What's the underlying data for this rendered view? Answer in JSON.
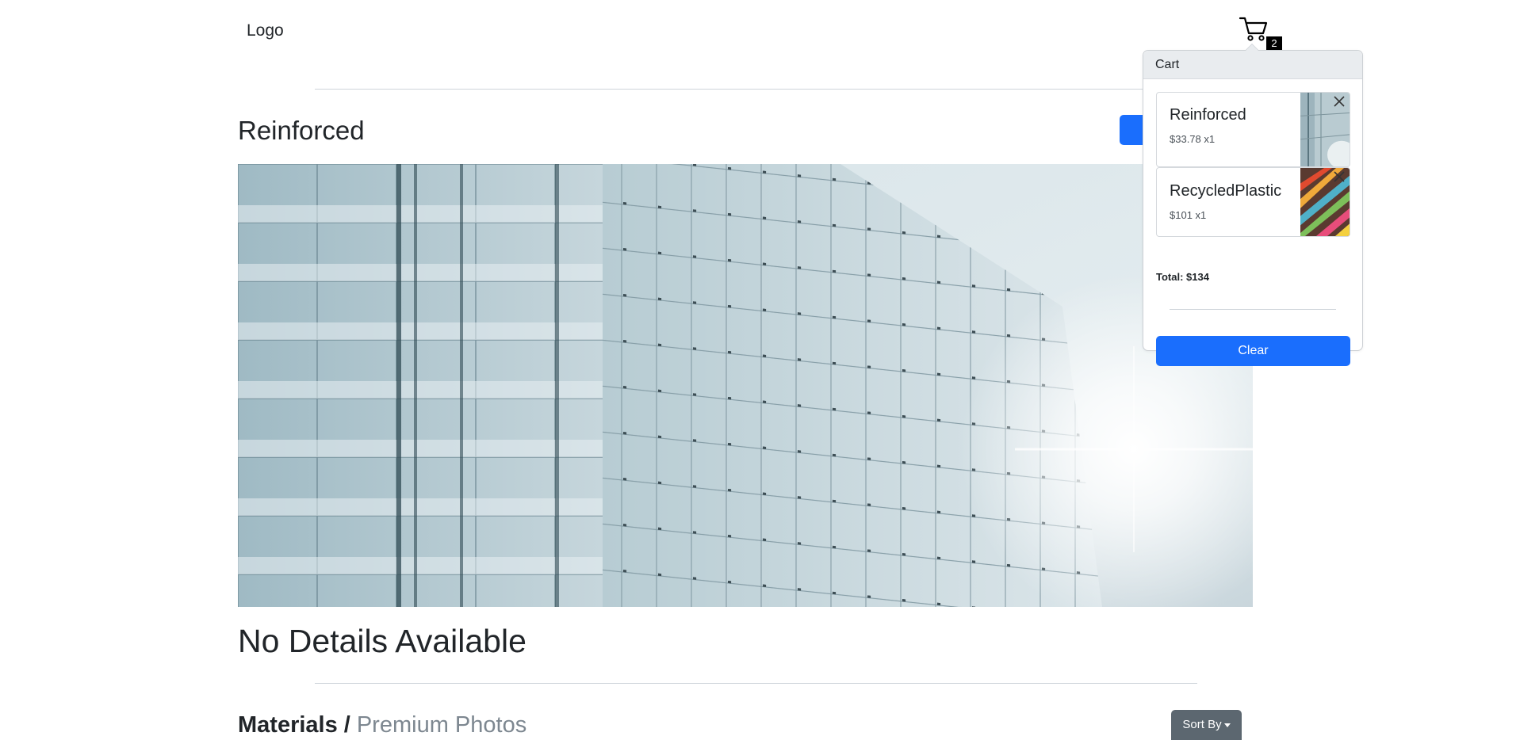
{
  "header": {
    "logo_text": "Logo",
    "cart_count": "2"
  },
  "product": {
    "title": "Reinforced",
    "details_text": "No Details Available"
  },
  "cart": {
    "title": "Cart",
    "items": [
      {
        "name": "Reinforced",
        "price_qty": "$33.78 x1"
      },
      {
        "name": "RecycledPlastic",
        "price_qty": "$101 x1"
      }
    ],
    "total": "Total: $134",
    "clear_label": "Clear"
  },
  "section": {
    "title": "Materials /",
    "subtitle": "Premium Photos",
    "sort_label": "Sort By"
  },
  "colors": {
    "primary": "#1a6efd",
    "secondary": "#5c6770",
    "badge": "#000000"
  },
  "icons": {
    "cart": "cart-icon",
    "remove": "close-icon",
    "sort_caret": "caret-down-icon"
  }
}
